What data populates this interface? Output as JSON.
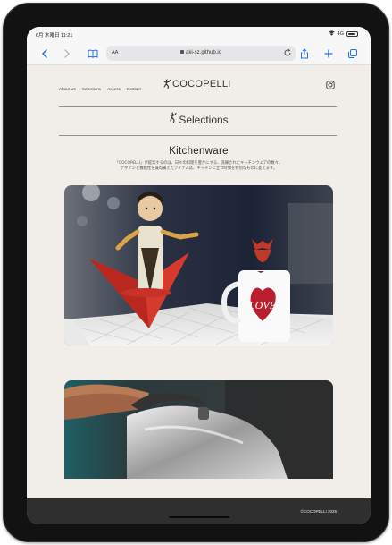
{
  "status": {
    "time": "6月 木曜日 11:21",
    "signal": "4G"
  },
  "browser": {
    "aa": "AA",
    "url": "aki-sz.github.io"
  },
  "nav": {
    "items": [
      "About Us",
      "Selections",
      "Access",
      "Contact"
    ]
  },
  "brand": {
    "name": "COCOPELLI"
  },
  "section": {
    "title": "Selections"
  },
  "category": {
    "title": "Kitchenware",
    "desc_line1": "「COCOPELLI」が提案するのは、日々の料理を豊かにする、洗練されたキッチンウェアの数々。",
    "desc_line2": "デザインと機能性を兼ね備えたアイテムは、キッチンに立つ時間を特別なものに変えます。"
  },
  "footer": {
    "copyright": "©COCOPELLI 2025"
  },
  "colors": {
    "page_bg": "#f1eee9",
    "footer_bg": "#2f2f2f",
    "accent_blue": "#1a73e8"
  }
}
